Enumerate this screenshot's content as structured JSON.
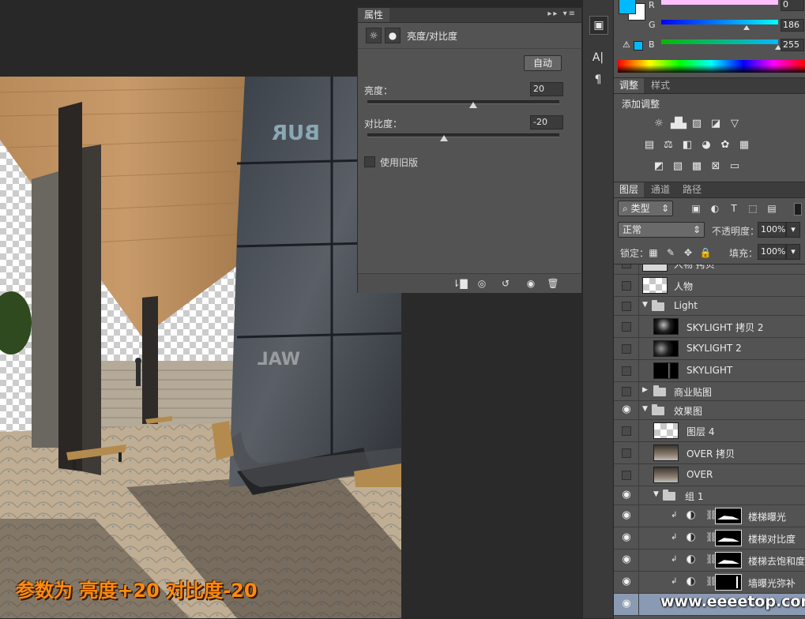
{
  "caption": "参数为 亮度+20 对比度-20",
  "watermark": "www.eeeetop.com",
  "properties": {
    "tab": "属性",
    "title": "亮度/对比度",
    "auto_button": "自动",
    "brightness_label": "亮度：",
    "brightness_value": "20",
    "brightness_fraction": 0.55,
    "contrast_label": "对比度：",
    "contrast_value": "-20",
    "contrast_fraction": 0.4,
    "legacy_label": "使用旧版",
    "legacy_checked": false
  },
  "color": {
    "foreground": "#00baff",
    "background": "#ffffff",
    "channels": [
      {
        "label": "R",
        "value": "0",
        "fraction": 0.0
      },
      {
        "label": "G",
        "value": "186",
        "fraction": 0.73
      },
      {
        "label": "B",
        "value": "255",
        "fraction": 1.0
      }
    ]
  },
  "adjustments": {
    "tabs": [
      "调整",
      "样式"
    ],
    "title": "添加调整",
    "icons_row1": [
      "brightness-icon",
      "levels-icon",
      "curves-icon",
      "exposure-icon",
      "vibrance-icon"
    ],
    "icons_row2": [
      "hue-saturation-icon",
      "color-balance-icon",
      "black-white-icon",
      "photo-filter-icon",
      "channel-mixer-icon",
      "color-lookup-icon"
    ],
    "icons_row3": [
      "invert-icon",
      "posterize-icon",
      "threshold-icon",
      "selective-color-icon",
      "gradient-map-icon"
    ]
  },
  "layers": {
    "tabs": [
      "图层",
      "通道",
      "路径"
    ],
    "filter_label": "类型",
    "blend_mode": "正常",
    "opacity_label": "不透明度：",
    "opacity_value": "100%",
    "lock_label": "锁定：",
    "fill_label": "填充：",
    "fill_value": "100%",
    "rows": [
      {
        "name": "人物 拷贝",
        "type": "layer",
        "visible": false,
        "indent": 0
      },
      {
        "name": "人物",
        "type": "layer",
        "visible": false,
        "indent": 0
      },
      {
        "name": "Light",
        "type": "group-open",
        "visible": false,
        "indent": 0
      },
      {
        "name": "SKYLIGHT 拷贝 2",
        "type": "layer",
        "visible": false,
        "indent": 1
      },
      {
        "name": "SKYLIGHT 2",
        "type": "layer",
        "visible": false,
        "indent": 1
      },
      {
        "name": "SKYLIGHT",
        "type": "layer",
        "visible": false,
        "indent": 1
      },
      {
        "name": "商业贴图",
        "type": "group-closed",
        "visible": false,
        "indent": 0
      },
      {
        "name": "效果图",
        "type": "group-open",
        "visible": true,
        "indent": 0
      },
      {
        "name": "图层 4",
        "type": "layer",
        "visible": false,
        "indent": 1
      },
      {
        "name": "OVER 拷贝",
        "type": "layer",
        "visible": false,
        "indent": 1
      },
      {
        "name": "OVER",
        "type": "layer",
        "visible": false,
        "indent": 1
      },
      {
        "name": "组 1",
        "type": "group-open",
        "visible": true,
        "indent": 1
      },
      {
        "name": "楼梯曝光",
        "type": "adjustment",
        "visible": true,
        "indent": 2
      },
      {
        "name": "楼梯对比度",
        "type": "adjustment",
        "visible": true,
        "indent": 2
      },
      {
        "name": "楼梯去饱和度",
        "type": "adjustment",
        "visible": true,
        "indent": 2
      },
      {
        "name": "墙曝光弥补",
        "type": "adjustment",
        "visible": true,
        "indent": 2
      },
      {
        "name": "",
        "type": "selected",
        "visible": true,
        "indent": 2
      }
    ]
  }
}
